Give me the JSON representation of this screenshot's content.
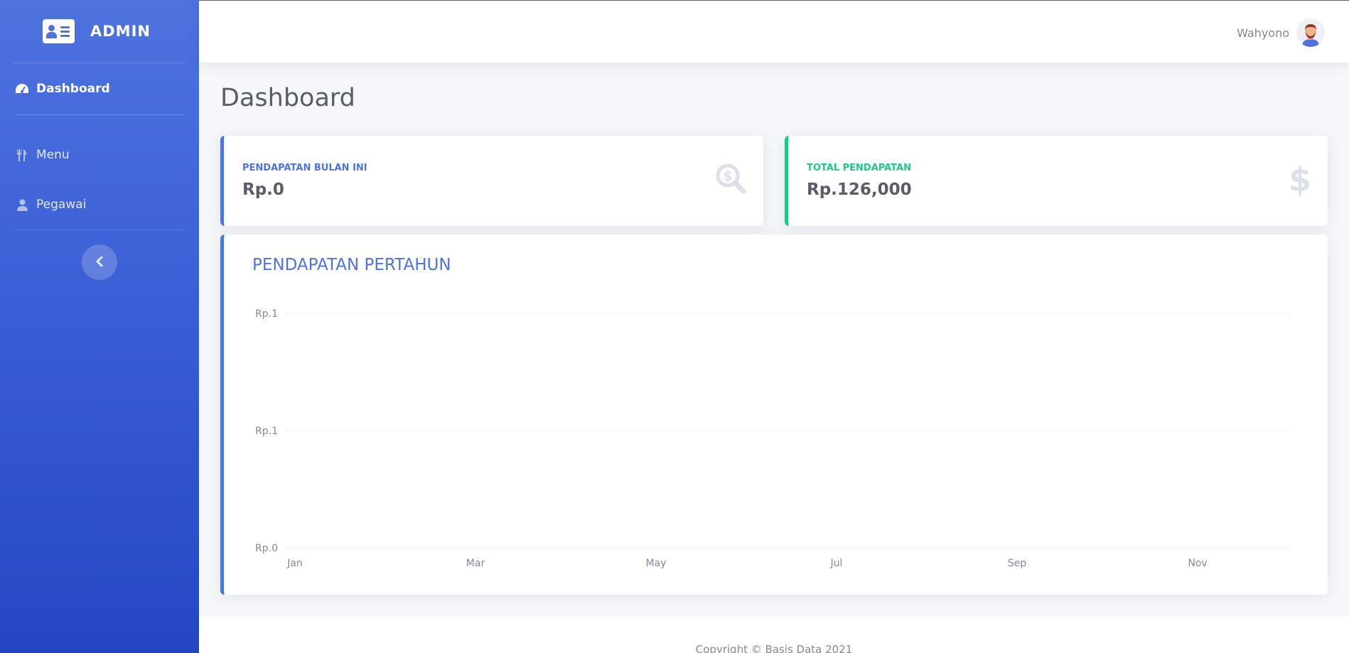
{
  "sidebar": {
    "brand": "ADMIN",
    "items": [
      {
        "label": "Dashboard",
        "icon": "tachometer-icon",
        "active": true
      },
      {
        "label": "Menu",
        "icon": "utensils-icon",
        "active": false
      },
      {
        "label": "Pegawai",
        "icon": "user-icon",
        "active": false
      }
    ]
  },
  "topbar": {
    "user_name": "Wahyono"
  },
  "page": {
    "title": "Dashboard"
  },
  "stats": [
    {
      "label": "PENDAPATAN BULAN INI",
      "value": "Rp.0",
      "icon": "search-dollar-icon",
      "color": "#4e73df"
    },
    {
      "label": "TOTAL PENDAPATAN",
      "value": "Rp.126,000",
      "icon": "dollar-icon",
      "color": "#1cc88a"
    }
  ],
  "chart_data": {
    "type": "line",
    "title": "PENDAPATAN PERTAHUN",
    "x_tick_labels": [
      "Jan",
      "Mar",
      "May",
      "Jul",
      "Sep",
      "Nov"
    ],
    "y_tick_labels": [
      "Rp.1",
      "Rp.1",
      "Rp.0"
    ],
    "series": [],
    "grid": true
  },
  "footer": {
    "text": "Copyright © Basis Data 2021"
  },
  "colors": {
    "primary": "#4e73df",
    "success": "#1cc88a",
    "text": "#5a5c69",
    "muted": "#858796"
  }
}
